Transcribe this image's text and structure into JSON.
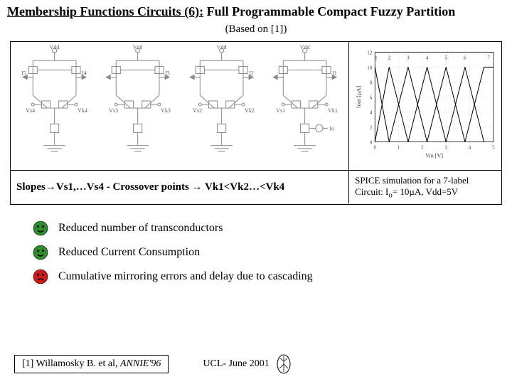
{
  "title_underlined": "Membership Functions Circuits (6):",
  "title_rest": " Full Programmable Compact Fuzzy Partition",
  "subtitle": "(Based on [1])",
  "schematic": {
    "vdd": "Vdd",
    "stages": [
      {
        "i_left": "I5",
        "i_right": "I4",
        "vs": "Vs4",
        "vk": "Vk4",
        "has_io": false
      },
      {
        "i_left": "",
        "i_right": "I3",
        "vs": "Vs3",
        "vk": "Vk3",
        "has_io": false
      },
      {
        "i_left": "",
        "i_right": "I2",
        "vs": "Vs2",
        "vk": "Vk2",
        "has_io": false
      },
      {
        "i_left": "",
        "i_right": "I1",
        "vs": "Vs1",
        "vk": "Vk1",
        "has_io": true
      }
    ],
    "io_label": "Io"
  },
  "chart_data": {
    "type": "line",
    "title": "",
    "xlabel": "Vin [V]",
    "ylabel": "Iout [µA]",
    "xlim": [
      0,
      5
    ],
    "ylim": [
      0,
      12
    ],
    "xticks": [
      0,
      1,
      2,
      3,
      4,
      5
    ],
    "yticks": [
      0,
      2,
      4,
      6,
      8,
      10,
      12
    ],
    "labels": [
      "1",
      "2",
      "3",
      "4",
      "5",
      "6",
      "7"
    ],
    "series": [
      {
        "name": "1",
        "x": [
          0.0,
          0.6
        ],
        "y": [
          10,
          0
        ]
      },
      {
        "name": "2",
        "x": [
          0.0,
          0.6,
          1.4
        ],
        "y": [
          0,
          10,
          0
        ]
      },
      {
        "name": "3",
        "x": [
          0.6,
          1.4,
          2.2
        ],
        "y": [
          0,
          10,
          0
        ]
      },
      {
        "name": "4",
        "x": [
          1.4,
          2.2,
          3.0
        ],
        "y": [
          0,
          10,
          0
        ]
      },
      {
        "name": "5",
        "x": [
          2.2,
          3.0,
          3.8
        ],
        "y": [
          0,
          10,
          0
        ]
      },
      {
        "name": "6",
        "x": [
          3.0,
          3.8,
          4.6
        ],
        "y": [
          0,
          10,
          0
        ]
      },
      {
        "name": "7",
        "x": [
          3.8,
          4.6,
          5.0
        ],
        "y": [
          0,
          10,
          10
        ]
      }
    ]
  },
  "caption_left_a": "Slopes",
  "caption_left_b": "Vs1,…Vs4   - Crossover points ",
  "caption_left_c": " Vk1<Vk2…<Vk4",
  "caption_right_line1": "SPICE simulation for a 7-label",
  "caption_right_line2a": "Circuit: I",
  "caption_right_line2b": "= 10",
  "caption_right_line2c": "A, Vdd=5V",
  "sub_o": "o",
  "mu": "µ",
  "bullets": [
    {
      "mood": "happy",
      "text": "Reduced number of transconductors"
    },
    {
      "mood": "happy",
      "text": "Reduced Current Consumption"
    },
    {
      "mood": "sad",
      "text": "Cumulative mirroring errors and delay due to cascading"
    }
  ],
  "reference_a": "[1] Willamosky B. et al, ",
  "reference_b": "ANNIE'96",
  "footer_center": "UCL- June 2001",
  "colors": {
    "happy": "#2e8b2e",
    "sad": "#cc1a1a",
    "grid": "#999",
    "schem": "#8a8a8a"
  }
}
